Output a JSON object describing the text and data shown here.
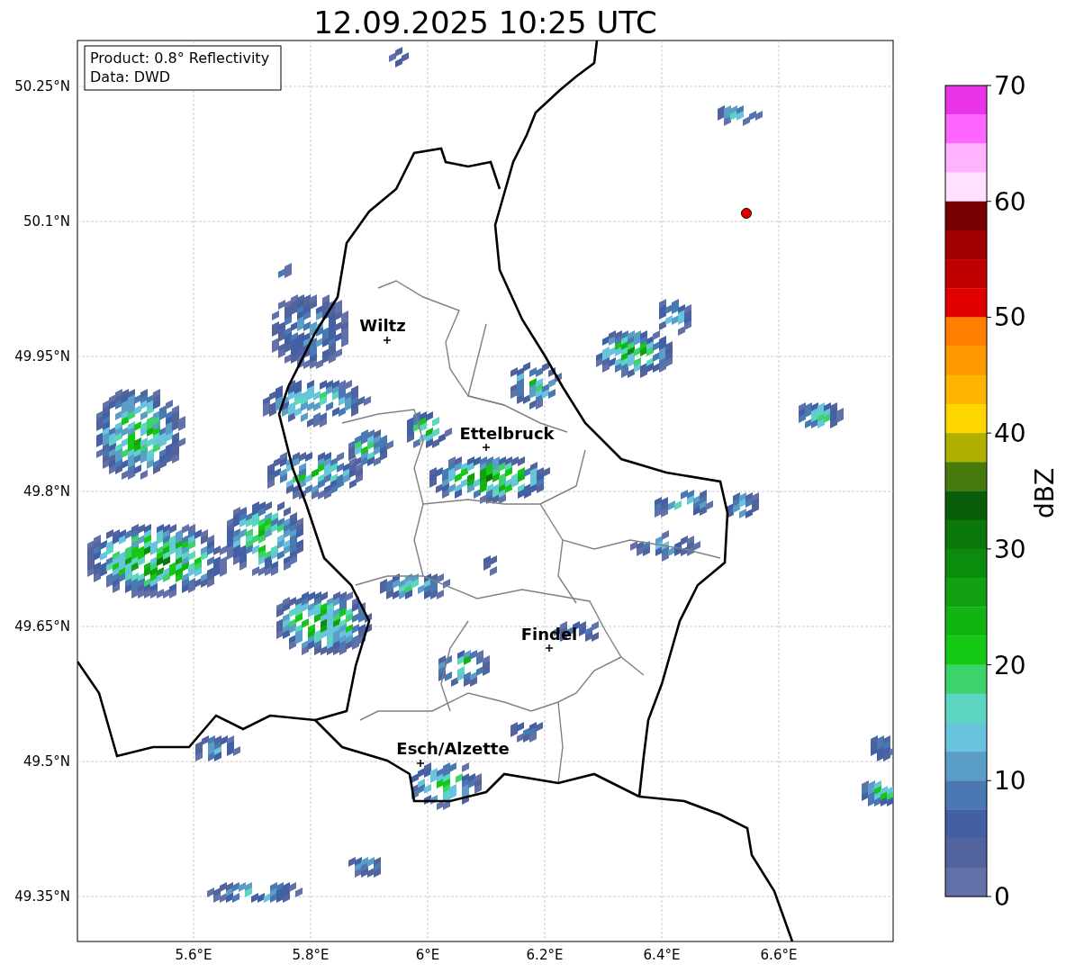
{
  "title": "12.09.2025 10:25 UTC",
  "info_box": {
    "lines": [
      "Product: 0.8° Reflectivity",
      "Data: DWD"
    ]
  },
  "map": {
    "kind": "map",
    "y_ticks": [
      "50.25°N",
      "50.1°N",
      "49.95°N",
      "49.8°N",
      "49.65°N",
      "49.5°N",
      "49.35°N"
    ],
    "x_ticks": [
      "5.6°E",
      "5.8°E",
      "6°E",
      "6.2°E",
      "6.4°E",
      "6.6°E"
    ],
    "cities": [
      {
        "name": "Wiltz"
      },
      {
        "name": "Ettelbruck"
      },
      {
        "name": "Findel"
      },
      {
        "name": "Esch/Alzette"
      }
    ]
  },
  "colorbar": {
    "label": "dBZ",
    "ticks": [
      "70",
      "60",
      "50",
      "40",
      "30",
      "20",
      "10",
      "0"
    ],
    "segments": [
      {
        "color": "#e833e8"
      },
      {
        "color": "#ff66ff"
      },
      {
        "color": "#ffb3ff"
      },
      {
        "color": "#ffe0ff"
      },
      {
        "color": "#780000"
      },
      {
        "color": "#a00000"
      },
      {
        "color": "#c00000"
      },
      {
        "color": "#e00000"
      },
      {
        "color": "#ff7f00"
      },
      {
        "color": "#ff9900"
      },
      {
        "color": "#ffb400"
      },
      {
        "color": "#ffd700"
      },
      {
        "color": "#afb000"
      },
      {
        "color": "#467a0c"
      },
      {
        "color": "#085e08"
      },
      {
        "color": "#0a780a"
      },
      {
        "color": "#0c8c0c"
      },
      {
        "color": "#10a010"
      },
      {
        "color": "#12b412"
      },
      {
        "color": "#14c814"
      },
      {
        "color": "#3cd46a"
      },
      {
        "color": "#5cd6c0"
      },
      {
        "color": "#68c4dc"
      },
      {
        "color": "#5a9ec8"
      },
      {
        "color": "#4a78b2"
      },
      {
        "color": "#4460a4"
      },
      {
        "color": "#51649e"
      },
      {
        "color": "#6272a8"
      }
    ]
  }
}
